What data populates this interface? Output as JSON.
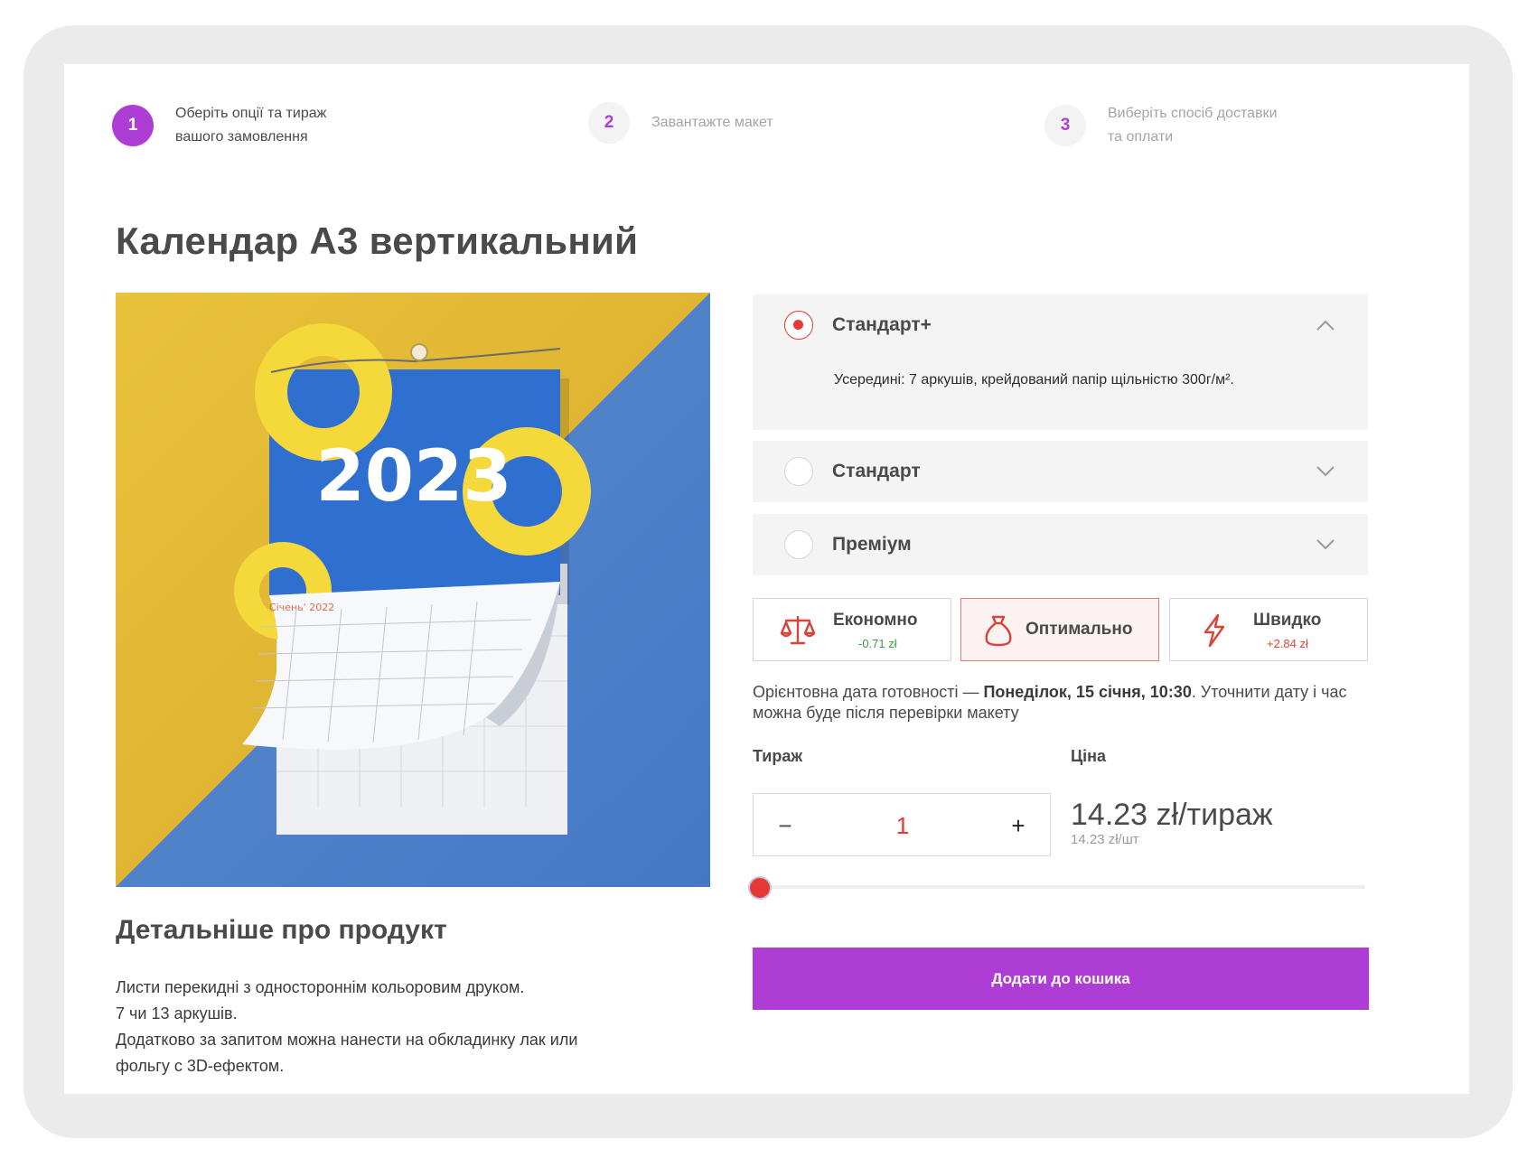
{
  "steps": [
    {
      "number": "1",
      "line1": "Оберіть опції та тираж",
      "line2": "вашого замовлення"
    },
    {
      "number": "2",
      "line1": "Завантажте макет",
      "line2": ""
    },
    {
      "number": "3",
      "line1": "Виберіть спосіб доставки",
      "line2": "та оплати"
    }
  ],
  "product": {
    "title": "Календар А3 вертикальний",
    "image": {
      "year_text": "2023",
      "month_text": "Січень' 2022"
    }
  },
  "details": {
    "title": "Детальніше про продукт",
    "lines": [
      "Листи перекидні з одностороннім кольоровим друком.",
      "7 чи 13 аркушів.",
      "Додатково за запитом можна нанести на обкладинку лак или",
      "фольгу с 3D-ефектом."
    ]
  },
  "options": [
    {
      "label": "Стандарт+",
      "selected": true,
      "expanded": true,
      "description": "Усередині: 7 аркушів, крейдований папір щільністю 300г/м²."
    },
    {
      "label": "Стандарт",
      "selected": false,
      "expanded": false
    },
    {
      "label": "Преміум",
      "selected": false,
      "expanded": false
    }
  ],
  "speeds": [
    {
      "name": "Економно",
      "price": "-0.71 zł",
      "icon": "scales-icon",
      "selected": false
    },
    {
      "name": "Оптимально",
      "price": "",
      "icon": "money-bag-icon",
      "selected": true
    },
    {
      "name": "Швидко",
      "price": "+2.84 zł",
      "icon": "lightning-icon",
      "selected": false
    }
  ],
  "ready": {
    "prefix": "Орієнтовна дата готовності — ",
    "date": "Понеділок, 15 січня, 10:30",
    "suffix": ". Уточнити дату і час можна буде після перевірки макету"
  },
  "quantity": {
    "label": "Тираж",
    "value": "1",
    "minus": "−",
    "plus": "+",
    "slider_fraction": 0.0
  },
  "price": {
    "label": "Ціна",
    "total": "14.23 zł/тираж",
    "unit": "14.23 zł/шт"
  },
  "cart_button": "Додати до кошика",
  "colors": {
    "accent": "#ae3dd6",
    "selected_red": "#e53935",
    "economy_green": "#3a9a45",
    "panel_bg": "#f4f4f4"
  }
}
